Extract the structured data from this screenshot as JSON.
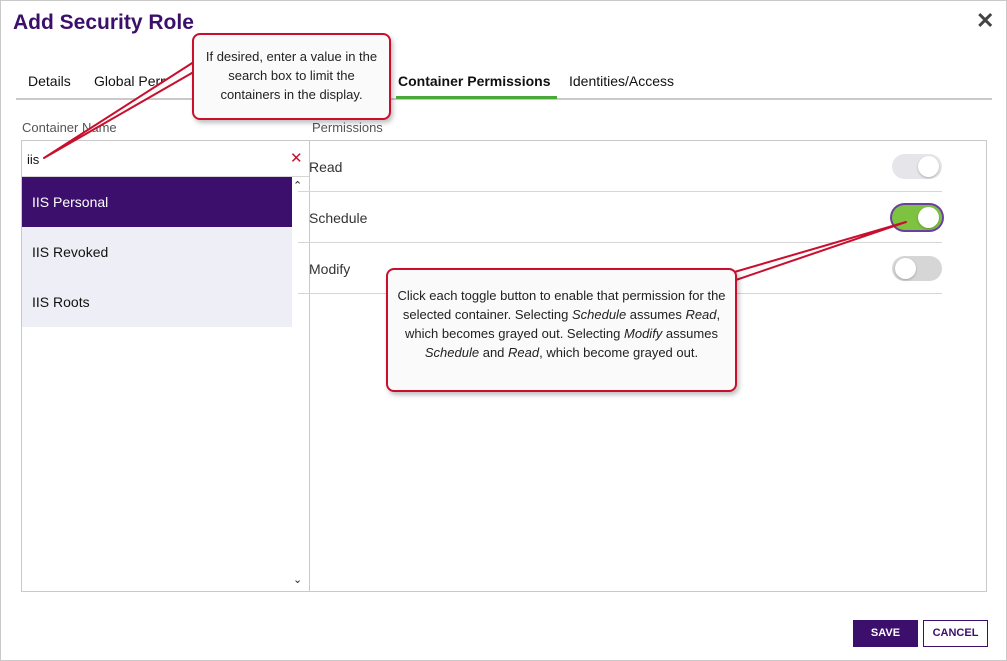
{
  "dialog": {
    "title": "Add Security Role",
    "close_glyph": "✕"
  },
  "tabs": [
    {
      "label": "Details",
      "active": false
    },
    {
      "label": "Global Perm",
      "active": false
    },
    {
      "label": "Container Permissions",
      "active": true
    },
    {
      "label": "Identities/Access",
      "active": false
    }
  ],
  "container": {
    "column_label": "Container Name",
    "search_value": "iis",
    "clear_glyph": "✕",
    "items": [
      {
        "label": "IIS Personal",
        "selected": true
      },
      {
        "label": "IIS Revoked",
        "selected": false
      },
      {
        "label": "IIS Roots",
        "selected": false
      }
    ],
    "scroll_up_glyph": "⌃",
    "scroll_down_glyph": "⌄"
  },
  "permissions": {
    "column_label": "Permissions",
    "rows": [
      {
        "label": "Read",
        "state": "on-grayed"
      },
      {
        "label": "Schedule",
        "state": "on"
      },
      {
        "label": "Modify",
        "state": "off"
      }
    ]
  },
  "callouts": {
    "search_tip": "If desired, enter a value in the search box to limit the containers in the display.",
    "toggle_tip_html": "Click each toggle button to enable that permission for the selected container. Selecting <i>Schedule</i> assumes <i>Read</i>, which becomes grayed out. Selecting <i>Modify</i> assumes <i>Schedule</i> and <i>Read</i>, which become grayed out."
  },
  "buttons": {
    "save": "SAVE",
    "cancel": "CANCEL"
  },
  "colors": {
    "brand_purple": "#3b0f6b",
    "toggle_green": "#7ec242",
    "callout_border": "#c8102e",
    "active_tab_underline": "#4aa83a"
  }
}
